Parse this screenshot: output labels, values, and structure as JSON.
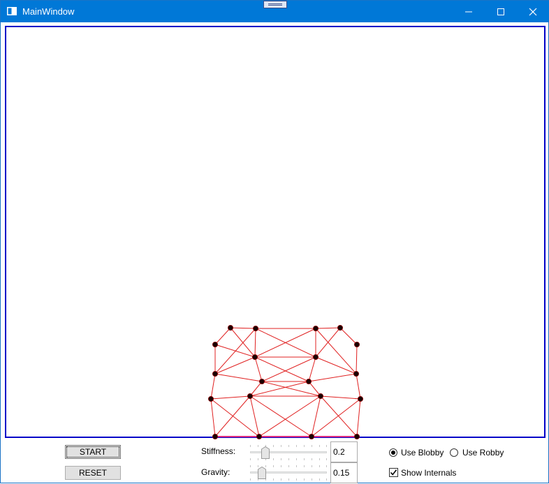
{
  "window": {
    "title": "MainWindow"
  },
  "controls": {
    "start_label": "START",
    "reset_label": "RESET",
    "stiffness": {
      "label": "Stiffness:",
      "value": "0.2",
      "slider_fraction": 0.2
    },
    "gravity": {
      "label": "Gravity:",
      "value": "0.15",
      "slider_fraction": 0.15
    },
    "use_blobby": {
      "label": "Use Blobby",
      "selected": true
    },
    "use_robby": {
      "label": "Use Robby",
      "selected": false
    },
    "show_internals": {
      "label": "Show Internals",
      "checked": true
    }
  },
  "colors": {
    "titlebar": "#0078d7",
    "canvas_border": "#0000c8",
    "spring": "#e02020",
    "node": "#1a0000",
    "ground": "#e040e0"
  },
  "icons": [
    "app-icon",
    "minimize-icon",
    "maximize-icon",
    "close-icon"
  ]
}
